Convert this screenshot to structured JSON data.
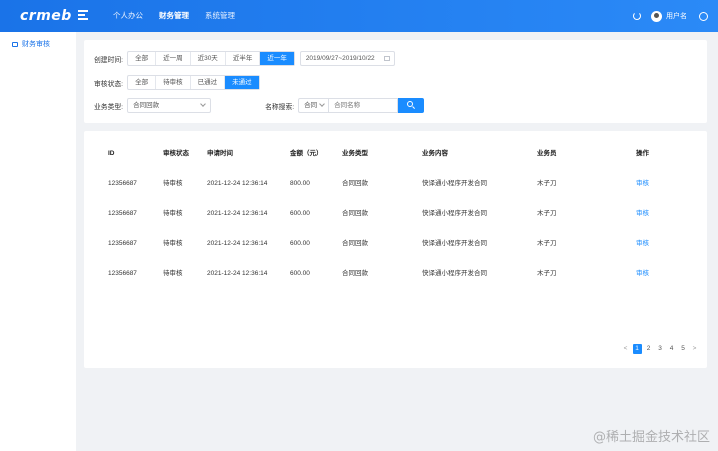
{
  "header": {
    "logo": "crmeb",
    "nav": [
      "个人办公",
      "财务管理",
      "系统管理"
    ],
    "active_nav": "财务管理",
    "username": "用户名"
  },
  "sidebar": {
    "items": [
      {
        "label": "财务审核",
        "icon": "folder-icon"
      }
    ]
  },
  "filters": {
    "created_label": "创建时间:",
    "time_options": [
      "全部",
      "近一周",
      "近30天",
      "近半年",
      "近一年"
    ],
    "time_active": "近一年",
    "date_range": "2019/09/27~2019/10/22",
    "status_label": "审核状态:",
    "status_options": [
      "全部",
      "待审核",
      "已通过",
      "未通过"
    ],
    "status_active": "未通过",
    "type_label": "业务类型:",
    "type_value": "合同回款",
    "name_search_label": "名称搜索:",
    "search_select": "合同",
    "search_placeholder": "合同名称"
  },
  "table": {
    "columns": [
      "ID",
      "审核状态",
      "申请时间",
      "金额（元）",
      "业务类型",
      "业务内容",
      "业务员",
      "操作"
    ],
    "rows": [
      {
        "id": "12356687",
        "status": "待审核",
        "time": "2021-12-24 12:36:14",
        "amount": "800.00",
        "type": "合同回款",
        "content": "快译通小程序开发合同",
        "staff": "木子刀",
        "op": "审核"
      },
      {
        "id": "12356687",
        "status": "待审核",
        "time": "2021-12-24 12:36:14",
        "amount": "600.00",
        "type": "合同回款",
        "content": "快译通小程序开发合同",
        "staff": "木子刀",
        "op": "审核"
      },
      {
        "id": "12356687",
        "status": "待审核",
        "time": "2021-12-24 12:36:14",
        "amount": "600.00",
        "type": "合同回款",
        "content": "快译通小程序开发合同",
        "staff": "木子刀",
        "op": "审核"
      },
      {
        "id": "12356687",
        "status": "待审核",
        "time": "2021-12-24 12:36:14",
        "amount": "600.00",
        "type": "合同回款",
        "content": "快译通小程序开发合同",
        "staff": "木子刀",
        "op": "审核"
      }
    ]
  },
  "pagination": {
    "prev": "<",
    "pages": [
      "1",
      "2",
      "3",
      "4",
      "5"
    ],
    "current": "1",
    "next": ">"
  },
  "watermark": "@稀土掘金技术社区",
  "colors": {
    "primary": "#1a8cff",
    "header": "#1a73e8",
    "background": "#f0f2f5"
  }
}
